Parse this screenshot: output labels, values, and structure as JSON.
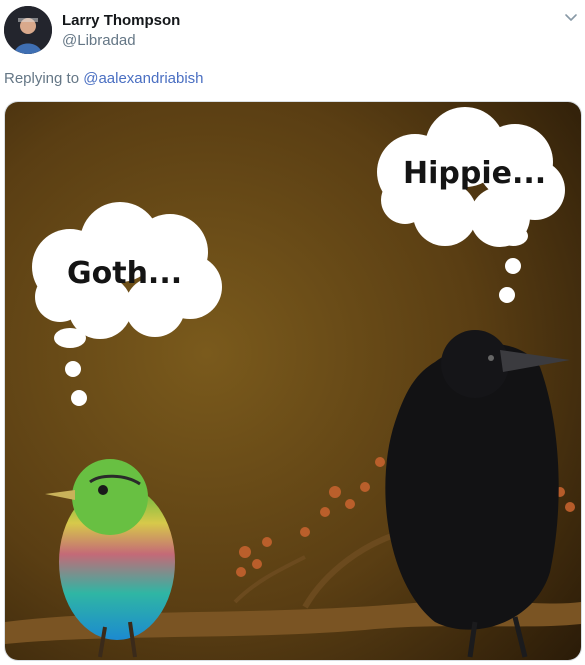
{
  "tweet": {
    "author_name": "Larry Thompson",
    "author_handle": "@Libradad",
    "reply_prefix": "Replying to",
    "reply_to": "@aalexandriabish"
  },
  "image": {
    "left_bubble_text": "Goth...",
    "right_bubble_text": "Hippie..."
  },
  "icons": {
    "menu": "chevron-down-icon",
    "avatar": "user-avatar"
  },
  "colors": {
    "link": "#4a6fc2",
    "muted_text": "#657786",
    "name_text": "#14171a"
  }
}
